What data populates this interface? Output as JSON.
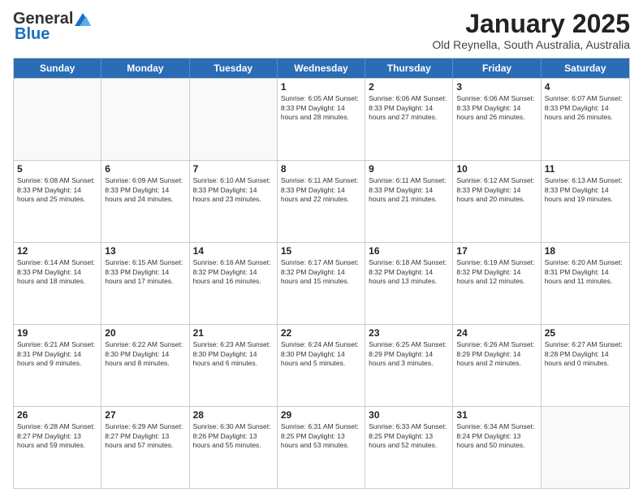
{
  "logo": {
    "general": "General",
    "blue": "Blue"
  },
  "header": {
    "month": "January 2025",
    "location": "Old Reynella, South Australia, Australia"
  },
  "weekdays": [
    "Sunday",
    "Monday",
    "Tuesday",
    "Wednesday",
    "Thursday",
    "Friday",
    "Saturday"
  ],
  "weeks": [
    [
      {
        "day": "",
        "info": ""
      },
      {
        "day": "",
        "info": ""
      },
      {
        "day": "",
        "info": ""
      },
      {
        "day": "1",
        "info": "Sunrise: 6:05 AM\nSunset: 8:33 PM\nDaylight: 14 hours\nand 28 minutes."
      },
      {
        "day": "2",
        "info": "Sunrise: 6:06 AM\nSunset: 8:33 PM\nDaylight: 14 hours\nand 27 minutes."
      },
      {
        "day": "3",
        "info": "Sunrise: 6:06 AM\nSunset: 8:33 PM\nDaylight: 14 hours\nand 26 minutes."
      },
      {
        "day": "4",
        "info": "Sunrise: 6:07 AM\nSunset: 8:33 PM\nDaylight: 14 hours\nand 26 minutes."
      }
    ],
    [
      {
        "day": "5",
        "info": "Sunrise: 6:08 AM\nSunset: 8:33 PM\nDaylight: 14 hours\nand 25 minutes."
      },
      {
        "day": "6",
        "info": "Sunrise: 6:09 AM\nSunset: 8:33 PM\nDaylight: 14 hours\nand 24 minutes."
      },
      {
        "day": "7",
        "info": "Sunrise: 6:10 AM\nSunset: 8:33 PM\nDaylight: 14 hours\nand 23 minutes."
      },
      {
        "day": "8",
        "info": "Sunrise: 6:11 AM\nSunset: 8:33 PM\nDaylight: 14 hours\nand 22 minutes."
      },
      {
        "day": "9",
        "info": "Sunrise: 6:11 AM\nSunset: 8:33 PM\nDaylight: 14 hours\nand 21 minutes."
      },
      {
        "day": "10",
        "info": "Sunrise: 6:12 AM\nSunset: 8:33 PM\nDaylight: 14 hours\nand 20 minutes."
      },
      {
        "day": "11",
        "info": "Sunrise: 6:13 AM\nSunset: 8:33 PM\nDaylight: 14 hours\nand 19 minutes."
      }
    ],
    [
      {
        "day": "12",
        "info": "Sunrise: 6:14 AM\nSunset: 8:33 PM\nDaylight: 14 hours\nand 18 minutes."
      },
      {
        "day": "13",
        "info": "Sunrise: 6:15 AM\nSunset: 8:33 PM\nDaylight: 14 hours\nand 17 minutes."
      },
      {
        "day": "14",
        "info": "Sunrise: 6:16 AM\nSunset: 8:32 PM\nDaylight: 14 hours\nand 16 minutes."
      },
      {
        "day": "15",
        "info": "Sunrise: 6:17 AM\nSunset: 8:32 PM\nDaylight: 14 hours\nand 15 minutes."
      },
      {
        "day": "16",
        "info": "Sunrise: 6:18 AM\nSunset: 8:32 PM\nDaylight: 14 hours\nand 13 minutes."
      },
      {
        "day": "17",
        "info": "Sunrise: 6:19 AM\nSunset: 8:32 PM\nDaylight: 14 hours\nand 12 minutes."
      },
      {
        "day": "18",
        "info": "Sunrise: 6:20 AM\nSunset: 8:31 PM\nDaylight: 14 hours\nand 11 minutes."
      }
    ],
    [
      {
        "day": "19",
        "info": "Sunrise: 6:21 AM\nSunset: 8:31 PM\nDaylight: 14 hours\nand 9 minutes."
      },
      {
        "day": "20",
        "info": "Sunrise: 6:22 AM\nSunset: 8:30 PM\nDaylight: 14 hours\nand 8 minutes."
      },
      {
        "day": "21",
        "info": "Sunrise: 6:23 AM\nSunset: 8:30 PM\nDaylight: 14 hours\nand 6 minutes."
      },
      {
        "day": "22",
        "info": "Sunrise: 6:24 AM\nSunset: 8:30 PM\nDaylight: 14 hours\nand 5 minutes."
      },
      {
        "day": "23",
        "info": "Sunrise: 6:25 AM\nSunset: 8:29 PM\nDaylight: 14 hours\nand 3 minutes."
      },
      {
        "day": "24",
        "info": "Sunrise: 6:26 AM\nSunset: 8:29 PM\nDaylight: 14 hours\nand 2 minutes."
      },
      {
        "day": "25",
        "info": "Sunrise: 6:27 AM\nSunset: 8:28 PM\nDaylight: 14 hours\nand 0 minutes."
      }
    ],
    [
      {
        "day": "26",
        "info": "Sunrise: 6:28 AM\nSunset: 8:27 PM\nDaylight: 13 hours\nand 59 minutes."
      },
      {
        "day": "27",
        "info": "Sunrise: 6:29 AM\nSunset: 8:27 PM\nDaylight: 13 hours\nand 57 minutes."
      },
      {
        "day": "28",
        "info": "Sunrise: 6:30 AM\nSunset: 8:26 PM\nDaylight: 13 hours\nand 55 minutes."
      },
      {
        "day": "29",
        "info": "Sunrise: 6:31 AM\nSunset: 8:25 PM\nDaylight: 13 hours\nand 53 minutes."
      },
      {
        "day": "30",
        "info": "Sunrise: 6:33 AM\nSunset: 8:25 PM\nDaylight: 13 hours\nand 52 minutes."
      },
      {
        "day": "31",
        "info": "Sunrise: 6:34 AM\nSunset: 8:24 PM\nDaylight: 13 hours\nand 50 minutes."
      },
      {
        "day": "",
        "info": ""
      }
    ]
  ]
}
